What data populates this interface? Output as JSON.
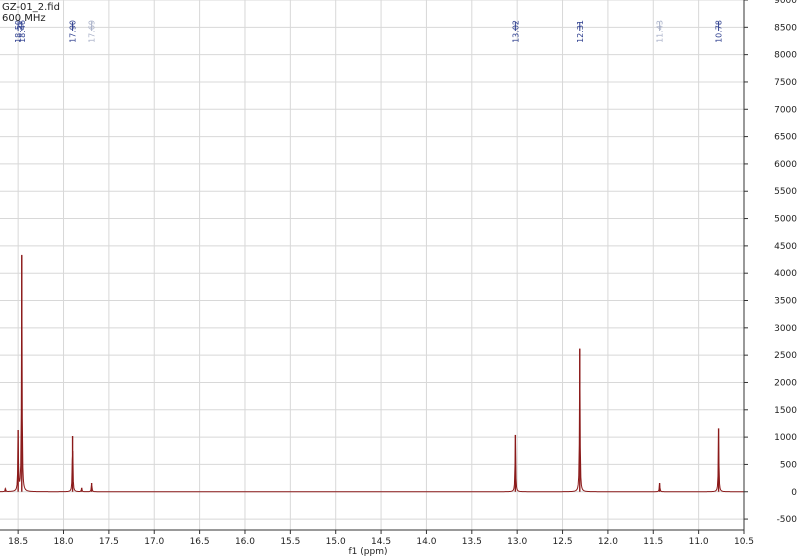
{
  "chart_data": {
    "type": "line",
    "title_lines": [
      "GZ-01_2.fid",
      "600 MHz"
    ],
    "xlabel": "f1 (ppm)",
    "ylabel": "",
    "xlim": [
      18.7,
      10.5
    ],
    "ylim": [
      -700,
      9000
    ],
    "x_ticks": [
      18.5,
      18.0,
      17.5,
      17.0,
      16.5,
      16.0,
      15.5,
      15.0,
      14.5,
      14.0,
      13.5,
      13.0,
      12.5,
      12.0,
      11.5,
      11.0,
      10.5
    ],
    "y_ticks": [
      -500,
      0,
      500,
      1000,
      1500,
      2000,
      2500,
      3000,
      3500,
      4000,
      4500,
      5000,
      5500,
      6000,
      6500,
      7000,
      7500,
      8000,
      8500,
      9000
    ],
    "series": [
      {
        "peaks": [
          {
            "x": 18.64,
            "y": 60
          },
          {
            "x": 18.5,
            "y": 1130
          },
          {
            "x": 18.46,
            "y": 4330
          },
          {
            "x": 17.9,
            "y": 1020
          },
          {
            "x": 17.8,
            "y": 70
          },
          {
            "x": 17.69,
            "y": 160
          },
          {
            "x": 13.02,
            "y": 1040
          },
          {
            "x": 12.31,
            "y": 2620
          },
          {
            "x": 11.43,
            "y": 160
          },
          {
            "x": 10.78,
            "y": 1160
          }
        ]
      }
    ],
    "peak_labels": [
      {
        "x": 18.5,
        "text": "18.50",
        "faded": false
      },
      {
        "x": 18.46,
        "text": "18.46",
        "faded": false
      },
      {
        "x": 17.9,
        "text": "17.90",
        "faded": false
      },
      {
        "x": 17.69,
        "text": "17.69",
        "faded": true
      },
      {
        "x": 13.02,
        "text": "13.02",
        "faded": false
      },
      {
        "x": 12.31,
        "text": "12.31",
        "faded": false
      },
      {
        "x": 11.43,
        "text": "11.43",
        "faded": true
      },
      {
        "x": 10.78,
        "text": "10.78",
        "faded": false
      }
    ],
    "grid": true,
    "colors": {
      "spectrum": "#8b1a1a",
      "grid": "#d8d8d8",
      "axis": "#333333",
      "peak_label": "#2e3f8f",
      "peak_label_faded": "#a8b0c8"
    }
  }
}
